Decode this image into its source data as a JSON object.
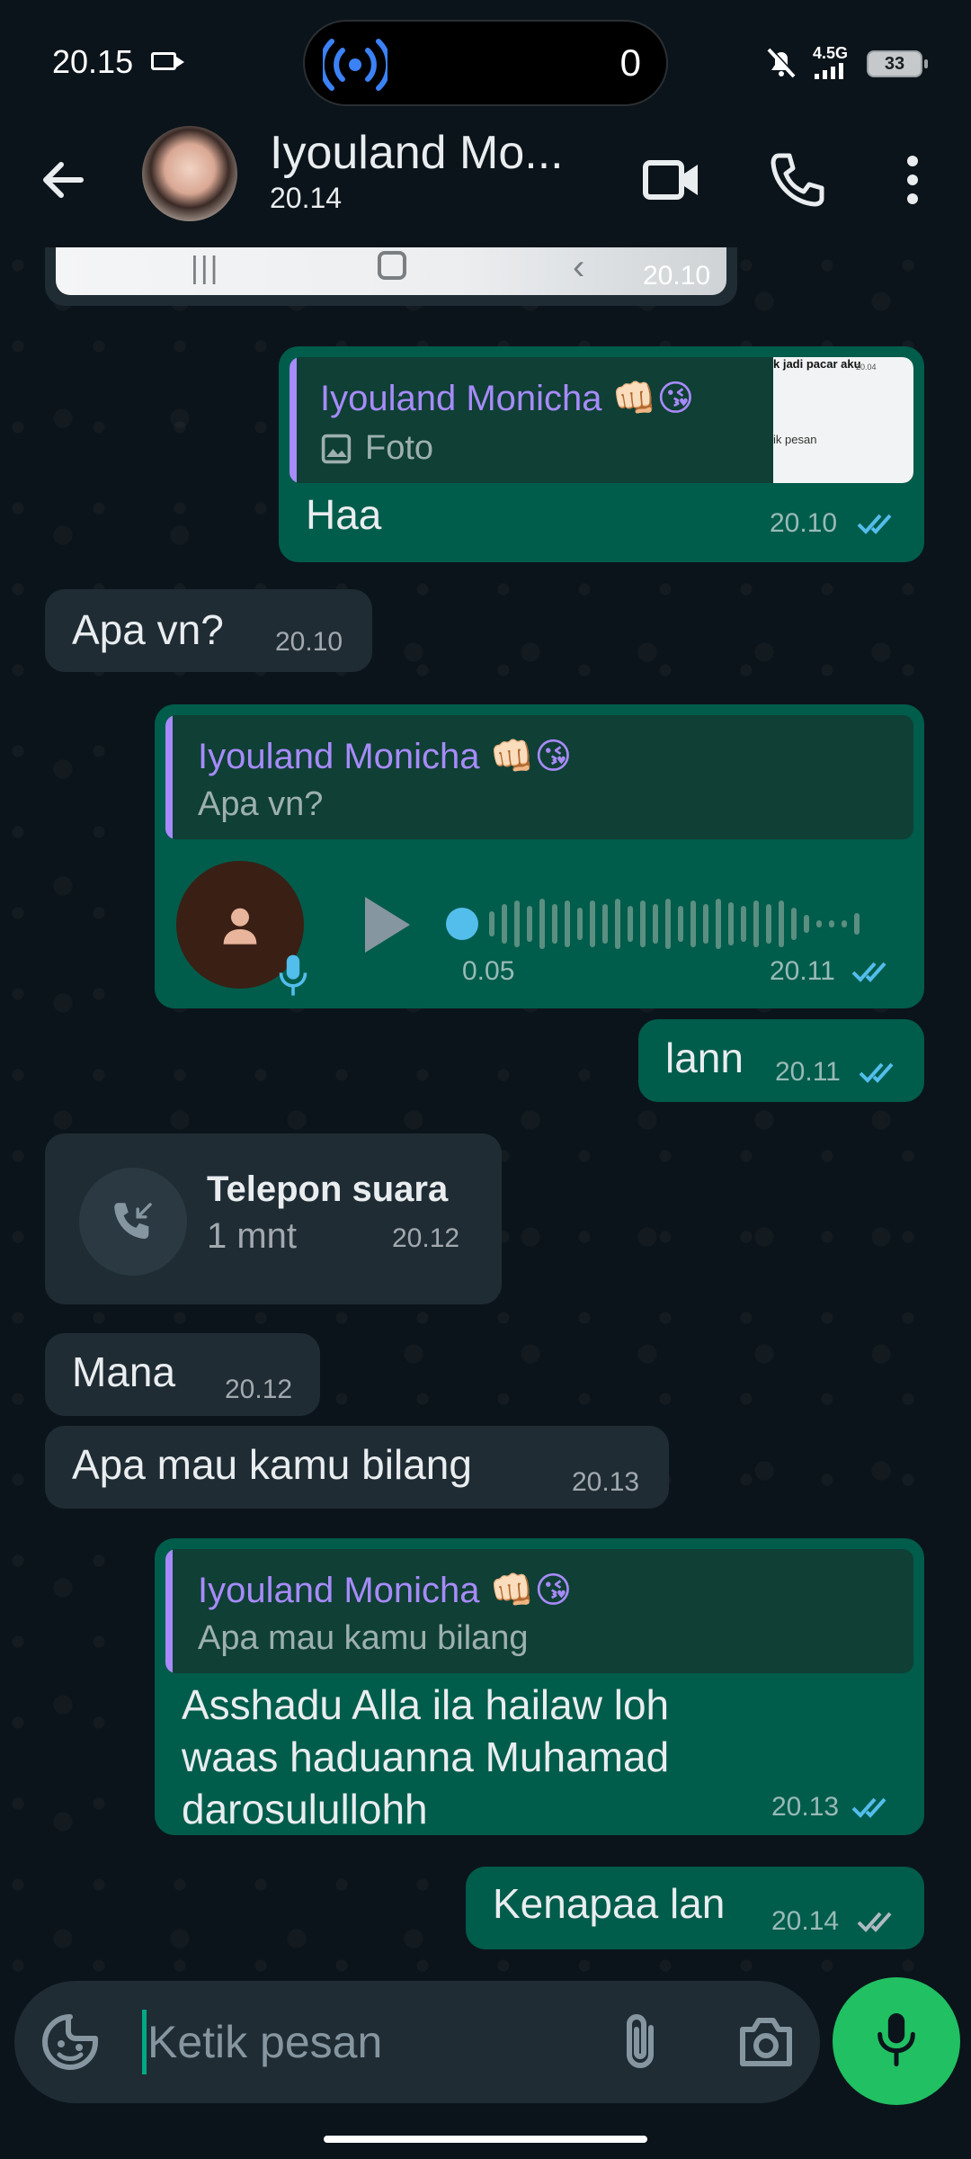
{
  "status_bar": {
    "time": "20.15",
    "badge_count": "0",
    "network": "4.5G",
    "battery": "33"
  },
  "header": {
    "contact_name": "Iyouland Mo...",
    "subtitle": "20.14"
  },
  "messages": {
    "m0": {
      "time": "20.10"
    },
    "m1": {
      "quote_name": "Iyouland Monicha 👊🏻😘",
      "quote_text": "Foto",
      "thumb_text_1": "k jadi pacar aku",
      "thumb_text_2": "20.04",
      "thumb_text_3": "ik pesan",
      "text": "Haa",
      "time": "20.10"
    },
    "m2": {
      "text": "Apa vn?",
      "time": "20.10"
    },
    "m3": {
      "quote_name": "Iyouland Monicha 👊🏻😘",
      "quote_text": "Apa vn?",
      "duration": "0.05",
      "time": "20.11"
    },
    "m4": {
      "text": "lann",
      "time": "20.11"
    },
    "m5": {
      "call_title": "Telepon suara",
      "call_duration": "1 mnt",
      "time": "20.12"
    },
    "m6": {
      "text": "Mana",
      "time": "20.12"
    },
    "m7": {
      "text": "Apa mau kamu bilang",
      "time": "20.13"
    },
    "m8": {
      "quote_name": "Iyouland Monicha 👊🏻😘",
      "quote_text": "Apa mau kamu bilang",
      "line1": "Asshadu Alla ila hailaw loh",
      "line2": "waas haduanna Muhamad",
      "line3": "darosulullohh",
      "time": "20.13"
    },
    "m9": {
      "text": "Kenapaa lan",
      "time": "20.14"
    }
  },
  "composer": {
    "placeholder": "Ketik pesan"
  },
  "colors": {
    "background": "#0b141a",
    "incoming_bubble": "#1f2c34",
    "outgoing_bubble": "#005c4b",
    "read_ticks": "#53bdeb",
    "quote_accent": "#a78bfa",
    "mic_button": "#21c063"
  },
  "icons": [
    "back-arrow-icon",
    "video-call-icon",
    "voice-call-icon",
    "more-options-icon",
    "sticker-icon",
    "attach-icon",
    "camera-icon",
    "mic-icon",
    "play-icon",
    "incoming-call-icon",
    "double-check-icon"
  ]
}
